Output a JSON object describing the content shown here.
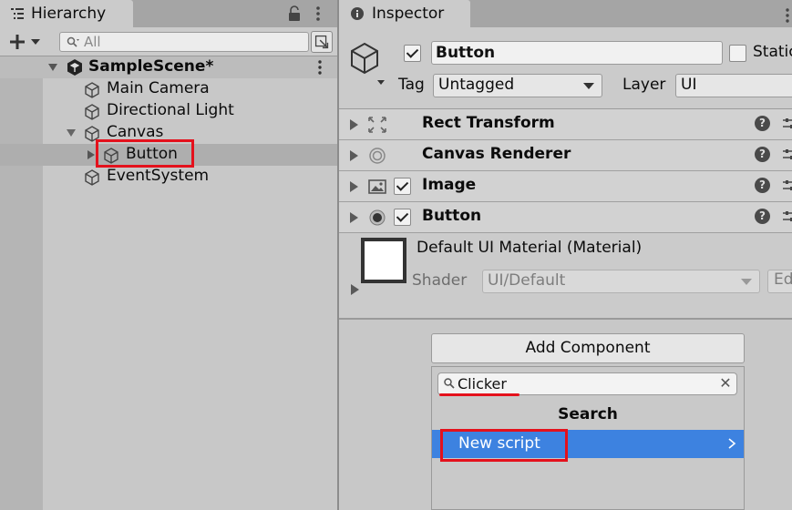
{
  "hierarchy": {
    "tab_label": "Hierarchy",
    "tab_icon": "list-icon",
    "search_placeholder": "All",
    "scene_name": "SampleScene*",
    "items": [
      {
        "label": "Main Camera",
        "icon": "gameobject-cube-icon"
      },
      {
        "label": "Directional Light",
        "icon": "gameobject-cube-icon"
      },
      {
        "label": "Canvas",
        "icon": "gameobject-cube-icon",
        "expanded": true
      },
      {
        "label": "Button",
        "icon": "gameobject-cube-icon",
        "selected": true
      },
      {
        "label": "EventSystem",
        "icon": "gameobject-cube-icon"
      }
    ],
    "highlight_color": "#e4111c"
  },
  "inspector": {
    "tab_label": "Inspector",
    "tab_icon": "info-icon",
    "object_name": "Button",
    "active": true,
    "static_label": "Static",
    "tag_label": "Tag",
    "tag_value": "Untagged",
    "layer_label": "Layer",
    "layer_value": "UI",
    "components": [
      {
        "name": "Rect Transform",
        "icon": "rect-transform-icon",
        "has_checkbox": false
      },
      {
        "name": "Canvas Renderer",
        "icon": "canvas-renderer-icon",
        "has_checkbox": false
      },
      {
        "name": "Image",
        "icon": "image-icon",
        "has_checkbox": true,
        "enabled": true
      },
      {
        "name": "Button",
        "icon": "button-component-icon",
        "has_checkbox": true,
        "enabled": true
      }
    ],
    "material": {
      "name": "Default UI Material (Material)",
      "shader_label": "Shader",
      "shader_value": "UI/Default",
      "edit_label": "Ed"
    },
    "add_component_label": "Add Component",
    "popup": {
      "search_value": "Clicker",
      "title": "Search",
      "item_label": "New script",
      "item_color": "#3d82e0"
    }
  }
}
